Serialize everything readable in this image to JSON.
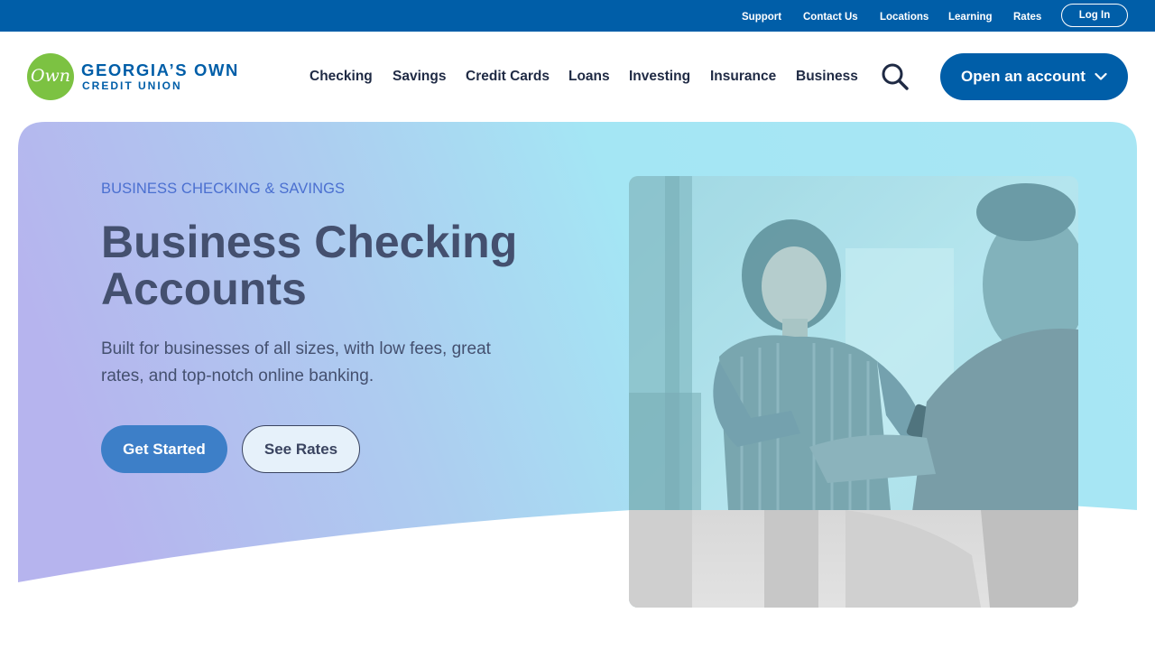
{
  "utility": {
    "links": [
      "Support",
      "Contact Us",
      "Locations",
      "Learning",
      "Rates"
    ],
    "login_label": "Log In"
  },
  "logo": {
    "script": "Own",
    "main": "GEORGIA’S OWN",
    "sub": "CREDIT UNION"
  },
  "nav": {
    "items": [
      "Checking",
      "Savings",
      "Credit Cards",
      "Loans",
      "Investing",
      "Insurance",
      "Business"
    ],
    "open_account_label": "Open an account"
  },
  "hero": {
    "eyebrow": "BUSINESS CHECKING & SAVINGS",
    "title": "Business Checking Accounts",
    "description": "Built for businesses of all sizes, with low fees, great rates, and top-notch online banking.",
    "primary_cta": "Get Started",
    "secondary_cta": "See Rates"
  },
  "icons": {
    "search": "search-icon",
    "chevron": "chevron-down-icon",
    "photo": "business-owner-photo"
  },
  "colors": {
    "brand_blue": "#005EA8",
    "logo_green": "#7CC242",
    "heading": "#44506F",
    "eyebrow": "#4A6FD0",
    "cta_primary": "#3D7FC8",
    "hero_gradient_start": "#B6B4EE",
    "hero_gradient_end": "#A4E6F4"
  }
}
